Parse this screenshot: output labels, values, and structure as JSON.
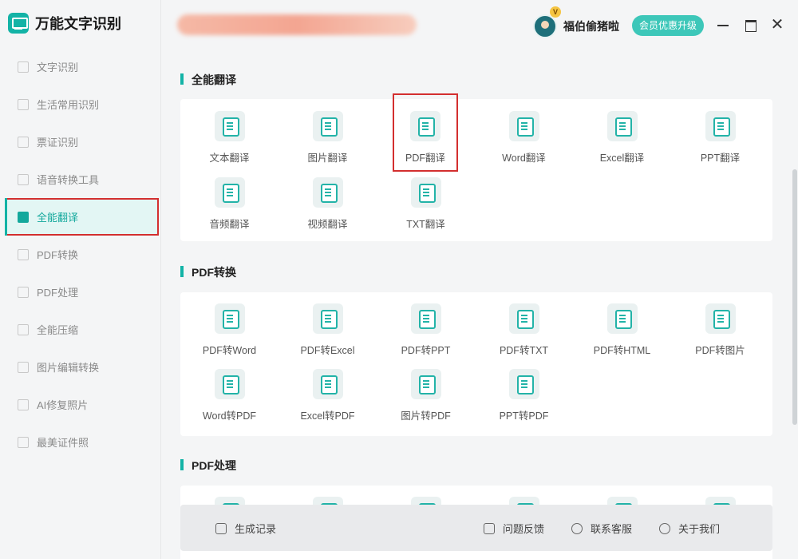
{
  "app": {
    "title": "万能文字识别"
  },
  "user": {
    "name": "福伯偷猪啦",
    "vip_badge": "V",
    "upgrade_label": "会员优惠升级"
  },
  "window": {
    "minimize": "—",
    "maximize": "▭",
    "close": "✕"
  },
  "sidebar": {
    "items": [
      {
        "label": "文字识别"
      },
      {
        "label": "生活常用识别"
      },
      {
        "label": "票证识别"
      },
      {
        "label": "语音转换工具"
      },
      {
        "label": "全能翻译"
      },
      {
        "label": "PDF转换"
      },
      {
        "label": "PDF处理"
      },
      {
        "label": "全能压缩"
      },
      {
        "label": "图片编辑转换"
      },
      {
        "label": "AI修复照片"
      },
      {
        "label": "最美证件照"
      }
    ],
    "active_index": 4
  },
  "sections": [
    {
      "title": "全能翻译",
      "tools": [
        {
          "label": "文本翻译"
        },
        {
          "label": "图片翻译"
        },
        {
          "label": "PDF翻译"
        },
        {
          "label": "Word翻译"
        },
        {
          "label": "Excel翻译"
        },
        {
          "label": "PPT翻译"
        },
        {
          "label": "音频翻译"
        },
        {
          "label": "视频翻译"
        },
        {
          "label": "TXT翻译"
        }
      ]
    },
    {
      "title": "PDF转换",
      "tools": [
        {
          "label": "PDF转Word"
        },
        {
          "label": "PDF转Excel"
        },
        {
          "label": "PDF转PPT"
        },
        {
          "label": "PDF转TXT"
        },
        {
          "label": "PDF转HTML"
        },
        {
          "label": "PDF转图片"
        },
        {
          "label": "Word转PDF"
        },
        {
          "label": "Excel转PDF"
        },
        {
          "label": "图片转PDF"
        },
        {
          "label": "PPT转PDF"
        }
      ]
    },
    {
      "title": "PDF处理"
    }
  ],
  "footer": {
    "history": "生成记录",
    "feedback": "问题反馈",
    "support": "联系客服",
    "about": "关于我们"
  },
  "colors": {
    "accent": "#13b3a6",
    "highlight": "#d32f2f"
  }
}
